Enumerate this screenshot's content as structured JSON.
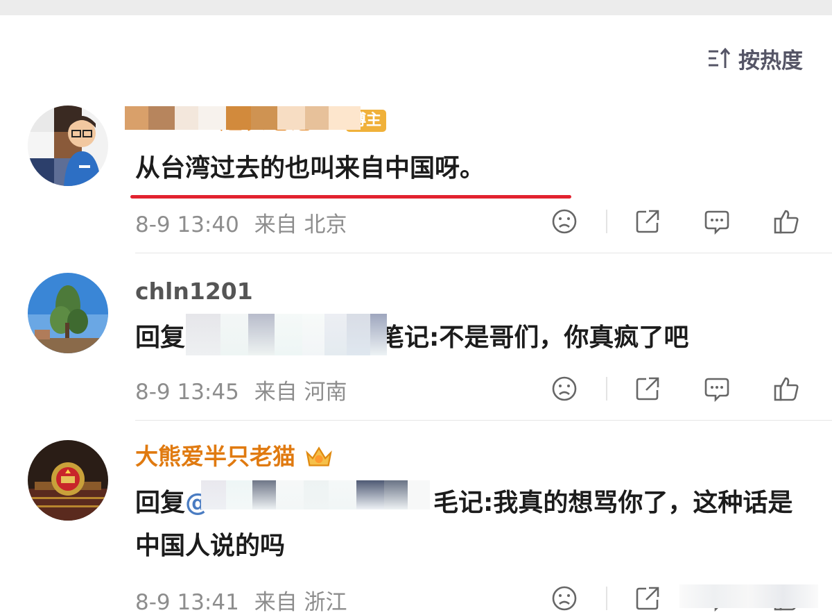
{
  "sort": {
    "label": "按热度",
    "icon": "sort-icon"
  },
  "comments": [
    {
      "username_visible": "赵表毛记",
      "badge": "博主",
      "text": "从台湾过去的也叫来自中国呀。",
      "time": "8-9 13:40",
      "location": "来自 北京",
      "avatar_icon": "avatar-cartoon-man"
    },
    {
      "username_visible": "chln1201",
      "reply_prefix": "回复",
      "reply_suffix": "笔记:不是哥们，你真疯了吧",
      "time": "8-9 13:45",
      "location": "来自 河南",
      "avatar_icon": "avatar-tree"
    },
    {
      "username_visible": "大熊爱半只老猫",
      "reply_prefix": "回复",
      "reply_at": "@",
      "reply_suffix": "毛记:我真的想骂你了，这种话是",
      "text_line2": "中国人说的吗",
      "time": "8-9 13:41",
      "location": "来自 浙江",
      "avatar_icon": "avatar-emblem"
    }
  ],
  "colors": {
    "accent_underline": "#e2222f",
    "username_gold": "#e07a10",
    "meta_gray": "#8d8d8d",
    "badge_bg": "#f0b13a"
  },
  "icons": [
    "dislike-face-icon",
    "share-icon",
    "comment-icon",
    "like-icon"
  ]
}
